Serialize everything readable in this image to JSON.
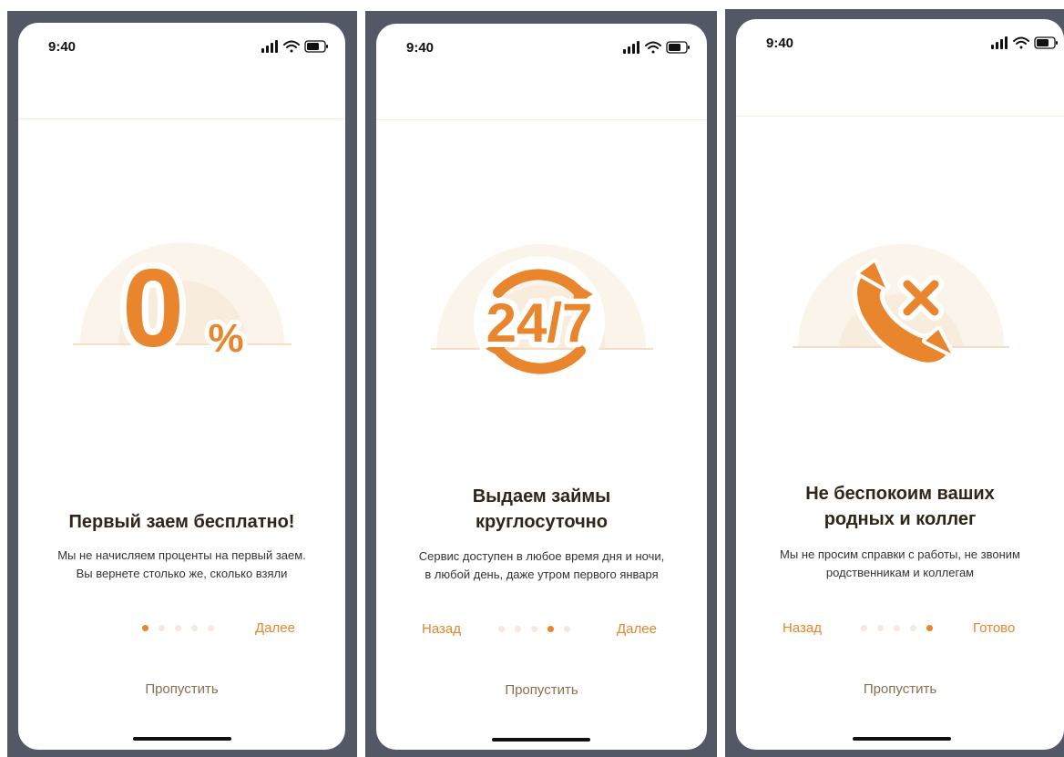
{
  "status": {
    "time": "9:40"
  },
  "brand": {
    "accent": "#e9852d",
    "title": "#2f2618",
    "skip": "#8a6f4e",
    "bezel": "#525866"
  },
  "slides": [
    {
      "title": "Первый заем бесплатно!",
      "description": "Мы не начисляем проценты на первый заем.\nВы вернете столько же, сколько взяли",
      "hero_icon": "zero-percent",
      "hero_text": "0",
      "hero_suffix": "%",
      "back_label": "",
      "next_label": "Далее",
      "skip_label": "Пропустить",
      "active_dot": 0,
      "dot_count": 5
    },
    {
      "title": "Выдаем займы\nкруглосуточно",
      "description": "Сервис доступен в любое время дня и ночи,\nв любой день, даже утром первого января",
      "hero_icon": "twenty-four-seven",
      "hero_text": "24/7",
      "back_label": "Назад",
      "next_label": "Далее",
      "skip_label": "Пропустить",
      "active_dot": 3,
      "dot_count": 5
    },
    {
      "title": "Не беспокоим ваших\nродных и коллег",
      "description": "Мы не просим справки с работы, не звоним\nродственникам и коллегам",
      "hero_icon": "phone-cancel",
      "back_label": "Назад",
      "next_label": "Готово",
      "skip_label": "Пропустить",
      "active_dot": 4,
      "dot_count": 5
    }
  ]
}
